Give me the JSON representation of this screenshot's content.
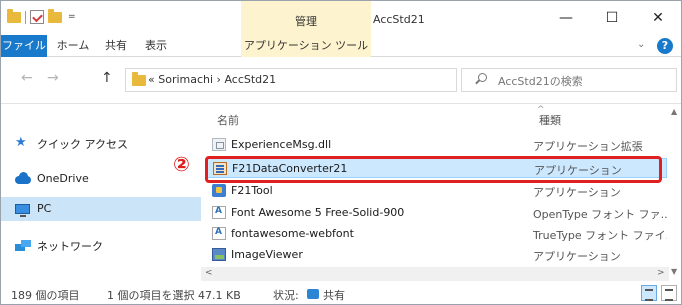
{
  "window": {
    "context_tab_label": "管理",
    "title": "AccStd21",
    "minimize_glyph": "—",
    "maximize_glyph": "☐",
    "close_glyph": "✕"
  },
  "quick_access": {
    "dropdown_glyph": "=",
    "divider_glyph": "|"
  },
  "ribbon": {
    "tabs": [
      "ファイル",
      "ホーム",
      "共有",
      "表示",
      "アプリケーション ツール"
    ],
    "expand_glyph": "⌄",
    "help_glyph": "?"
  },
  "address": {
    "back_glyph": "←",
    "forward_glyph": "→",
    "up_glyph": "↑",
    "path": "« Sorimachi › AccStd21",
    "dropdown_glyph": "⌄",
    "refresh_glyph": "↻"
  },
  "search": {
    "placeholder": "AccStd21の検索"
  },
  "nav_pane": {
    "items": [
      {
        "label": "クイック アクセス",
        "icon": "star-icon"
      },
      {
        "label": "OneDrive",
        "icon": "cloud-icon"
      },
      {
        "label": "PC",
        "icon": "computer-icon",
        "selected": true
      },
      {
        "label": "ネットワーク",
        "icon": "network-icon"
      }
    ]
  },
  "file_list": {
    "columns": {
      "name": "名前",
      "type": "種類"
    },
    "sort_glyph": "^",
    "rows": [
      {
        "name": "ExperienceMsg.dll",
        "type": "アプリケーション拡張",
        "icon": "dll-icon"
      },
      {
        "name": "F21DataConverter21",
        "type": "アプリケーション",
        "icon": "converter-icon",
        "selected": true
      },
      {
        "name": "F21Tool",
        "type": "アプリケーション",
        "icon": "tool-icon"
      },
      {
        "name": "Font Awesome 5 Free-Solid-900",
        "type": "OpenType フォント ファ...",
        "icon": "font-icon"
      },
      {
        "name": "fontawesome-webfont",
        "type": "TrueType フォント ファイ...",
        "icon": "font-icon"
      },
      {
        "name": "ImageViewer",
        "type": "アプリケーション",
        "icon": "image-viewer-icon"
      }
    ]
  },
  "scroll": {
    "up_glyph": "▲",
    "down_glyph": "▼",
    "left_glyph": "<",
    "right_glyph": ">"
  },
  "annotation": {
    "marker": "②",
    "color": "#e02020"
  },
  "status_bar": {
    "item_count": "189 個の項目",
    "selection": "1 個の項目を選択  47.1 KB",
    "state_label": "状況:",
    "state_value": "共有"
  },
  "colors": {
    "accent": "#1979ca",
    "context_tab": "#fdf4cf",
    "selection": "#cce8ff"
  }
}
